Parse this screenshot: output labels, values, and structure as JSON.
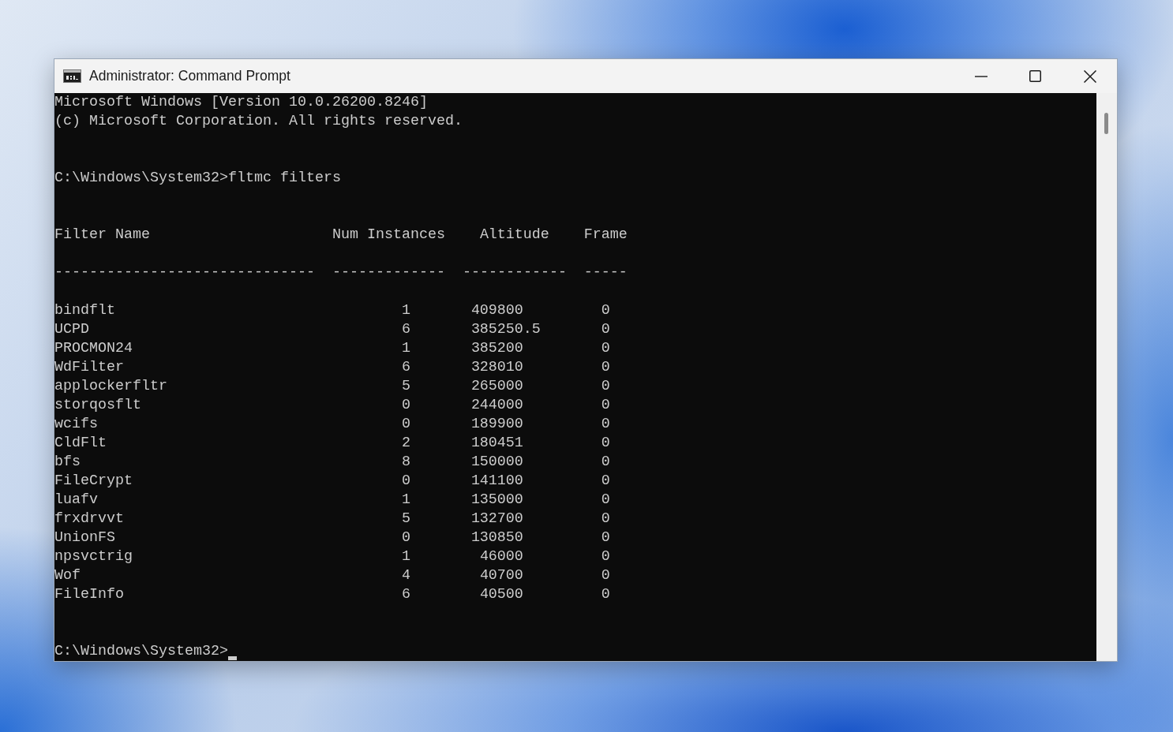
{
  "window": {
    "title": "Administrator: Command Prompt"
  },
  "console": {
    "header_lines": [
      "Microsoft Windows [Version 10.0.26200.8246]",
      "(c) Microsoft Corporation. All rights reserved."
    ],
    "command_line": "C:\\Windows\\System32>fltmc filters",
    "table": {
      "columns": [
        "Filter Name",
        "Num Instances",
        "Altitude",
        "Frame"
      ],
      "separators": [
        "------------------------------",
        "-------------",
        "------------",
        "-----"
      ],
      "rows": [
        {
          "filter_name": "bindflt",
          "num_instances": "1",
          "altitude": "409800",
          "frame": "0"
        },
        {
          "filter_name": "UCPD",
          "num_instances": "6",
          "altitude": "385250.5",
          "frame": "0"
        },
        {
          "filter_name": "PROCMON24",
          "num_instances": "1",
          "altitude": "385200",
          "frame": "0"
        },
        {
          "filter_name": "WdFilter",
          "num_instances": "6",
          "altitude": "328010",
          "frame": "0"
        },
        {
          "filter_name": "applockerfltr",
          "num_instances": "5",
          "altitude": "265000",
          "frame": "0"
        },
        {
          "filter_name": "storqosflt",
          "num_instances": "0",
          "altitude": "244000",
          "frame": "0"
        },
        {
          "filter_name": "wcifs",
          "num_instances": "0",
          "altitude": "189900",
          "frame": "0"
        },
        {
          "filter_name": "CldFlt",
          "num_instances": "2",
          "altitude": "180451",
          "frame": "0"
        },
        {
          "filter_name": "bfs",
          "num_instances": "8",
          "altitude": "150000",
          "frame": "0"
        },
        {
          "filter_name": "FileCrypt",
          "num_instances": "0",
          "altitude": "141100",
          "frame": "0"
        },
        {
          "filter_name": "luafv",
          "num_instances": "1",
          "altitude": "135000",
          "frame": "0"
        },
        {
          "filter_name": "frxdrvvt",
          "num_instances": "5",
          "altitude": "132700",
          "frame": "0"
        },
        {
          "filter_name": "UnionFS",
          "num_instances": "0",
          "altitude": "130850",
          "frame": "0"
        },
        {
          "filter_name": "npsvctrig",
          "num_instances": "1",
          "altitude": "46000",
          "frame": "0"
        },
        {
          "filter_name": "Wof",
          "num_instances": "4",
          "altitude": "40700",
          "frame": "0"
        },
        {
          "filter_name": "FileInfo",
          "num_instances": "6",
          "altitude": "40500",
          "frame": "0"
        }
      ]
    },
    "prompt": "C:\\Windows\\System32>"
  }
}
